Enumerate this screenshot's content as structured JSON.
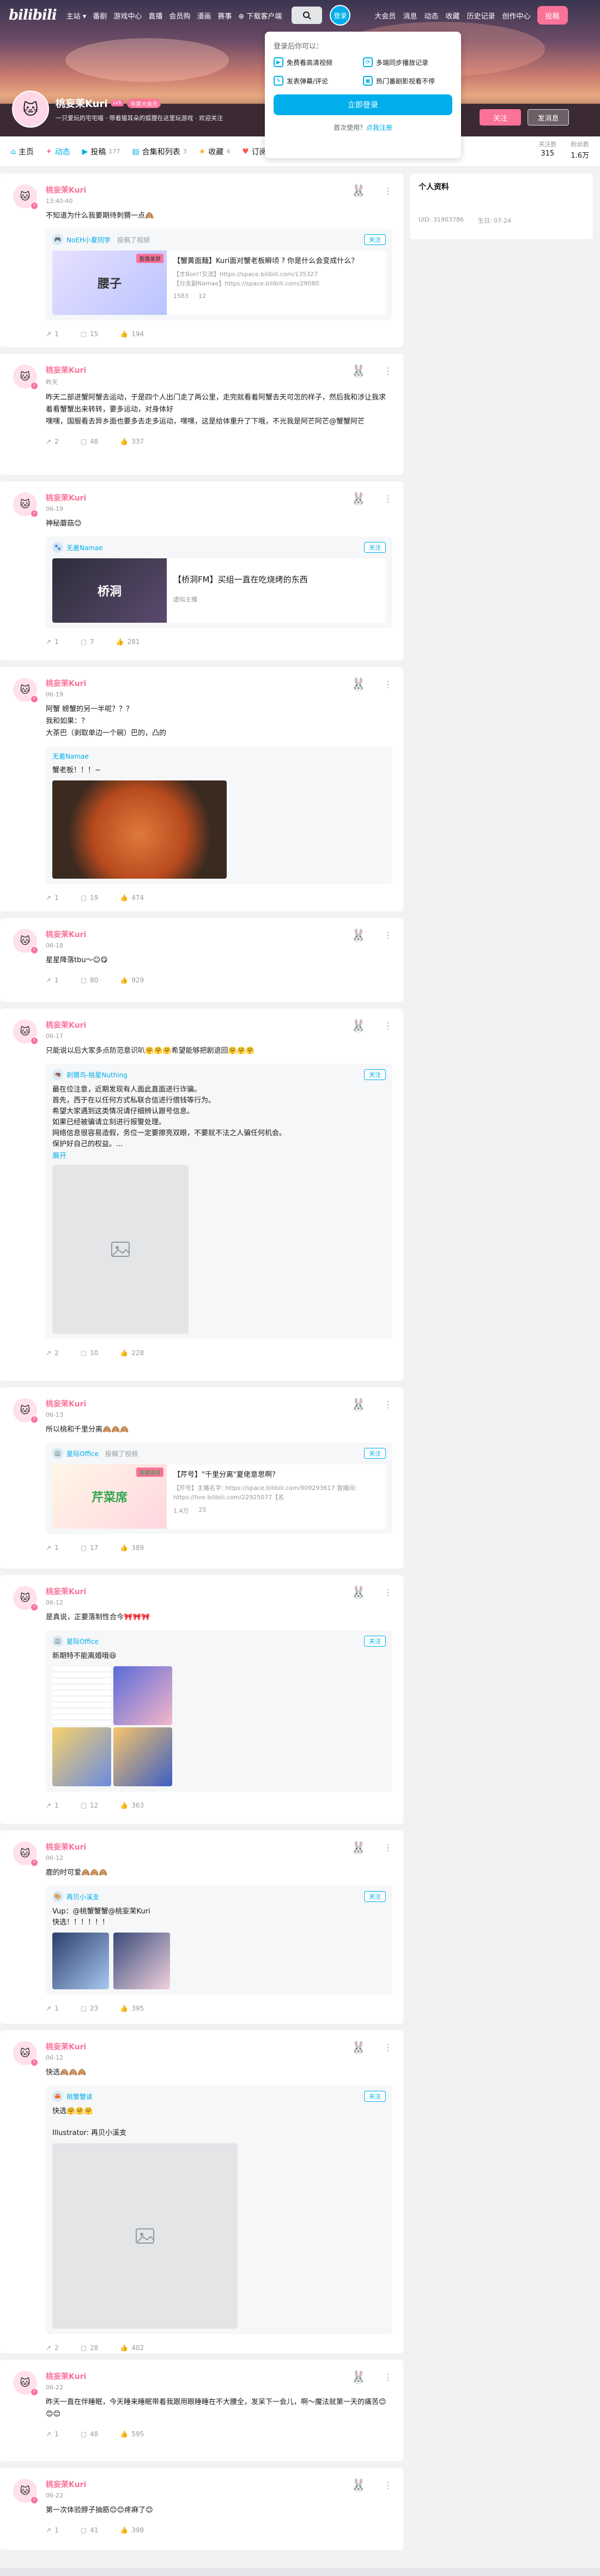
{
  "nav": {
    "logo": "bilibili",
    "left": [
      "主站 ▾",
      "番剧",
      "游戏中心",
      "直播",
      "会员购",
      "漫画",
      "赛事",
      "⊕ 下载客户端"
    ],
    "login": "登录",
    "right": [
      "大会员",
      "消息",
      "动态",
      "收藏",
      "历史记录",
      "创作中心"
    ],
    "upload": "投稿"
  },
  "popup": {
    "title": "登录后你可以：",
    "items": [
      "免费看高清视频",
      "多端同步播放记录",
      "发表弹幕/评论",
      "热门番剧影视看不停"
    ],
    "login_btn": "立即登录",
    "foot_text": "首次使用？",
    "foot_link": "点我注册"
  },
  "profile": {
    "name": "桃妄茉Kuri",
    "level": "LV6",
    "vip": "年度大会员",
    "sign": "一只爱玩的宅宅喵 · 带着猫耳朵的狐狸在这里玩游戏 · 欢迎关注",
    "follow_btn": "关注",
    "msg_btn": "发消息"
  },
  "tabs": [
    {
      "icon": "⌂",
      "label": "主页",
      "count": ""
    },
    {
      "icon": "✦",
      "label": "动态",
      "count": ""
    },
    {
      "icon": "▶",
      "label": "投稿",
      "count": "177"
    },
    {
      "icon": "▤",
      "label": "合集和列表",
      "count": "3"
    },
    {
      "icon": "★",
      "label": "收藏",
      "count": "4"
    },
    {
      "icon": "♥",
      "label": "订阅",
      "count": ""
    }
  ],
  "stats": [
    {
      "label": "关注数",
      "value": "315"
    },
    {
      "label": "粉丝数",
      "value": "1.6万"
    }
  ],
  "side": {
    "title": "个人资料",
    "uid": "UID: 31903786",
    "birthday": "生日: 07-24"
  },
  "posts": [
    {
      "name": "桃妄茉Kuri",
      "time": "13:40:40",
      "text": "不知道为什么我要期待刺猬一点🙈",
      "embed": {
        "author": "NoEH小夏同学",
        "tag": "投稿了视频",
        "title": "【蟹黄面麵】Kuri面对蟹老板瞬顷 ? 你是什么会变成什么？",
        "desc": "【才Bon!!交流】https://space.bilibili.com/135327\n【分支副Namae】https://space.bilibili.com/29080",
        "thumb": "腰子",
        "badge": "直播录屏",
        "views": "1583",
        "danmaku": "12"
      },
      "likes": "1",
      "comments": "15",
      "forwards": "194"
    },
    {
      "name": "桃妄茉Kuri",
      "time": "昨天",
      "text": "昨天二部进蟹阿蟹去运动，于是四个人出门走了两公里，走完就看着阿蟹去天可怎的样子，然后我和涉让我求着看蟹蟹出来转转，要多运动，对身体好\n嘿嘿，国服看去异乡面也要多去走多运动，嘿嘿，这是给体重升了下哦，不光我是阿芒阿芒@蟹蟹阿芒",
      "likes": "2",
      "comments": "48",
      "forwards": "337"
    },
    {
      "name": "桃妄茉Kuri",
      "time": "06-19",
      "text": "神秘蘑菇😊",
      "embed": {
        "author": "无差Namae",
        "tag": "",
        "title": "【桥洞FM】买组一直在吃烧烤的东西",
        "desc": "虚拟主播",
        "thumb": "桥洞",
        "badge": "",
        "views": "",
        "danmaku": ""
      },
      "likes": "1",
      "comments": "7",
      "forwards": "281"
    },
    {
      "name": "桃妄茉Kuri",
      "time": "06-19",
      "text": "阿蟹 螃蟹的另一半呢？？？\n我和如果：？\n大茶巴（剥取单边一个碗）巴的，凸的",
      "embed": {
        "author": "无差Namae",
        "tag": "",
        "text": "蟹老板！！！~"
      },
      "likes": "1",
      "comments": "19",
      "forwards": "474"
    },
    {
      "name": "桃妄茉Kuri",
      "time": "06-18",
      "text": "星星降落tbu～☺😋",
      "likes": "1",
      "comments": "80",
      "forwards": "929"
    },
    {
      "name": "桃妄茉Kuri",
      "time": "06-17",
      "text": "只能说以后大家多点防范意识叭🤗🤗🤗希望能够把剧退回🤗🤗🤗",
      "embed": {
        "author": "刺猬鸟-桃星Nuthing",
        "tag": "",
        "text": "最在位注意，近期发现有人面此直面进行诈骗。\n首先，西于在以任何方式私联合信进行借钱等行为。\n希望大家遇到这类情况请仔细辨认跟号信息。\n如果已经被骗请立刻进行报警处理。\n网络信息很容易造假，务位一定要擦亮双眼，不要就不法之人骗任何机会。\n保护好自己的权益。...",
        "expand": "展开"
      },
      "likes": "2",
      "comments": "10",
      "forwards": "228"
    },
    {
      "name": "桃妄茉Kuri",
      "time": "06-13",
      "text": "所以桃和千里分离🙈🙈🙈",
      "embed": {
        "author": "星际Office",
        "tag": "投稿了视频",
        "title": "【芹号】\"千里分离\"夏佬意思啊？",
        "desc": "【芹号】主播名字: https://space.bilibili.com/909293617 直播间: https://live.bilibili.com/22925077【名",
        "thumb": "芹菜席",
        "badge": "直播录屏",
        "views": "1.4万",
        "danmaku": "25"
      },
      "likes": "1",
      "comments": "17",
      "forwards": "389"
    },
    {
      "name": "桃妄茉Kuri",
      "time": "06-12",
      "text": "是真说，正要落制性合今🎀🎀🎀",
      "embed": {
        "author": "星际Office",
        "tag": "",
        "text": "新期特不能离婚哦😆"
      },
      "likes": "1",
      "comments": "12",
      "forwards": "363"
    },
    {
      "name": "桃妄茉Kuri",
      "time": "06-12",
      "text": "鹿的时可爱🙈🙈🙈",
      "embed": {
        "author": "再贝小溪支",
        "tag": "",
        "text": "Vup：@桃蟹蟹蟹@桃妄茉Kuri\n快选！！！！！！"
      },
      "likes": "1",
      "comments": "23",
      "forwards": "395"
    },
    {
      "name": "桃妄茉Kuri",
      "time": "06-12",
      "text": "快选🙈🙈🙈",
      "embed": {
        "author": "桃蟹蟹诶",
        "tag": "",
        "text": "快选🤗🤗🤗\n\nIllustrator: 再贝小溪支"
      },
      "likes": "2",
      "comments": "28",
      "forwards": "402"
    },
    {
      "name": "桃妄茉Kuri",
      "time": "06-22",
      "text": "昨天一直在伴睡眠，今天睡来睡眠带着我跟用眼睡睡在不大腰全，发呆下一会儿，啊～魔法就第一天的痛苦😊😊😊",
      "likes": "1",
      "comments": "48",
      "forwards": "595"
    },
    {
      "name": "桃妄茉Kuri",
      "time": "06-22",
      "text": "第一次体验脖子抽筋😊😊疼麻了😊",
      "likes": "1",
      "comments": "41",
      "forwards": "398"
    }
  ],
  "foot_labels": {
    "forward": "转发",
    "comment": "评论",
    "like": "点赞"
  }
}
